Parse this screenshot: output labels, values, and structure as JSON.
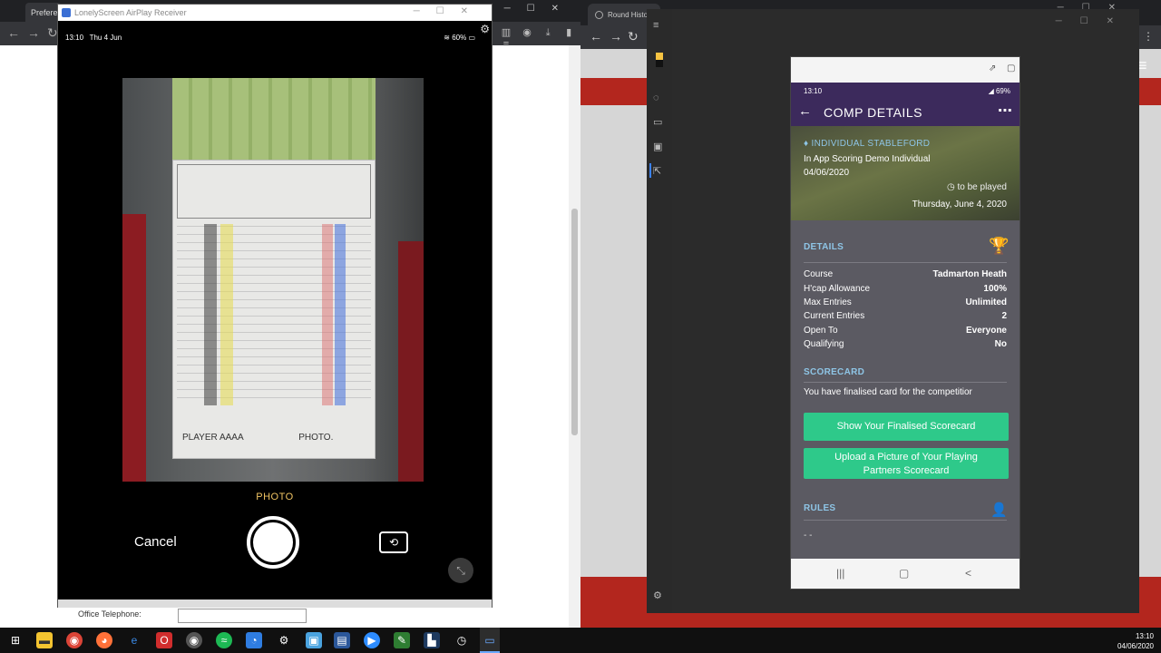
{
  "left_browser": {
    "tab_label": "Prefere",
    "office_label": "Office Telephone:",
    "office_value": ""
  },
  "lonely_window": {
    "title": "LonelyScreen AirPlay Receiver",
    "ios_time": "13:10",
    "ios_date": "Thu 4 Jun",
    "ios_battery": "60%",
    "photo_label": "PHOTO",
    "cancel_label": "Cancel",
    "card_signature": "PLAYER AAAA",
    "card_photo": "PHOTO."
  },
  "right_browser": {
    "tab_label": "Round Histo"
  },
  "phone": {
    "status_time": "13:10",
    "status_battery": "69%",
    "appbar_title": "COMP DETAILS",
    "comp_type": "INDIVIDUAL STABLEFORD",
    "comp_name": "In App Scoring Demo Individual",
    "comp_date": "04/06/2020",
    "to_be_played": "to be played",
    "play_date": "Thursday, June 4, 2020",
    "details_title": "DETAILS",
    "details": [
      {
        "key": "Course",
        "value": "Tadmarton Heath"
      },
      {
        "key": "H'cap Allowance",
        "value": "100%"
      },
      {
        "key": "Max Entries",
        "value": "Unlimited"
      },
      {
        "key": "Current Entries",
        "value": "2"
      },
      {
        "key": "Open To",
        "value": "Everyone"
      },
      {
        "key": "Qualifying",
        "value": "No"
      }
    ],
    "scorecard_title": "SCORECARD",
    "scorecard_text": "You have finalised card for the competitior",
    "show_scorecard_btn": "Show Your Finalised Scorecard",
    "upload_btn_line1": "Upload a Picture of Your Playing",
    "upload_btn_line2": "Partners Scorecard",
    "rules_title": "RULES",
    "rules_text": "- -"
  },
  "taskbar": {
    "clock_time": "13:10",
    "clock_date": "04/06/2020"
  }
}
